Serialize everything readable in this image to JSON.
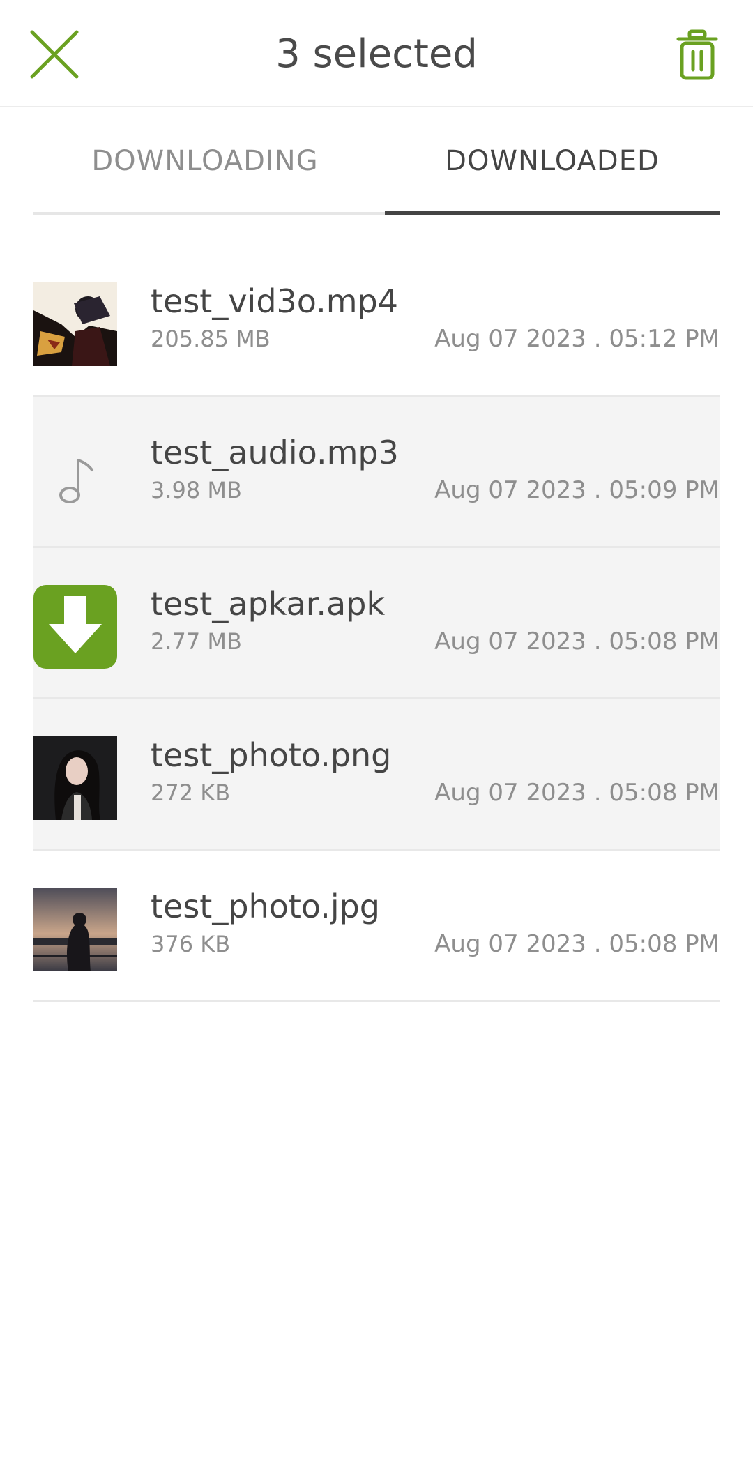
{
  "header": {
    "title": "3 selected",
    "close_icon": "close-icon",
    "delete_icon": "trash-icon",
    "accent_color": "#6aa121"
  },
  "tabs": [
    {
      "label": "DOWNLOADING",
      "active": false
    },
    {
      "label": "DOWNLOADED",
      "active": true
    }
  ],
  "files": [
    {
      "name": "test_vid3o.mp4",
      "size": "205.85 MB",
      "date": "Aug 07 2023 . 05:12 PM",
      "kind": "video",
      "selected": false
    },
    {
      "name": "test_audio.mp3",
      "size": "3.98 MB",
      "date": "Aug 07 2023 . 05:09 PM",
      "kind": "audio",
      "icon": "music-note-icon",
      "selected": true
    },
    {
      "name": "test_apkar.apk",
      "size": "2.77 MB",
      "date": "Aug 07 2023 . 05:08 PM",
      "kind": "apk",
      "icon": "download-arrow-icon",
      "selected": true
    },
    {
      "name": "test_photo.png",
      "size": "272 KB",
      "date": "Aug 07 2023 . 05:08 PM",
      "kind": "image",
      "selected": true
    },
    {
      "name": "test_photo.jpg",
      "size": "376 KB",
      "date": "Aug 07 2023 . 05:08 PM",
      "kind": "image",
      "selected": false
    }
  ]
}
